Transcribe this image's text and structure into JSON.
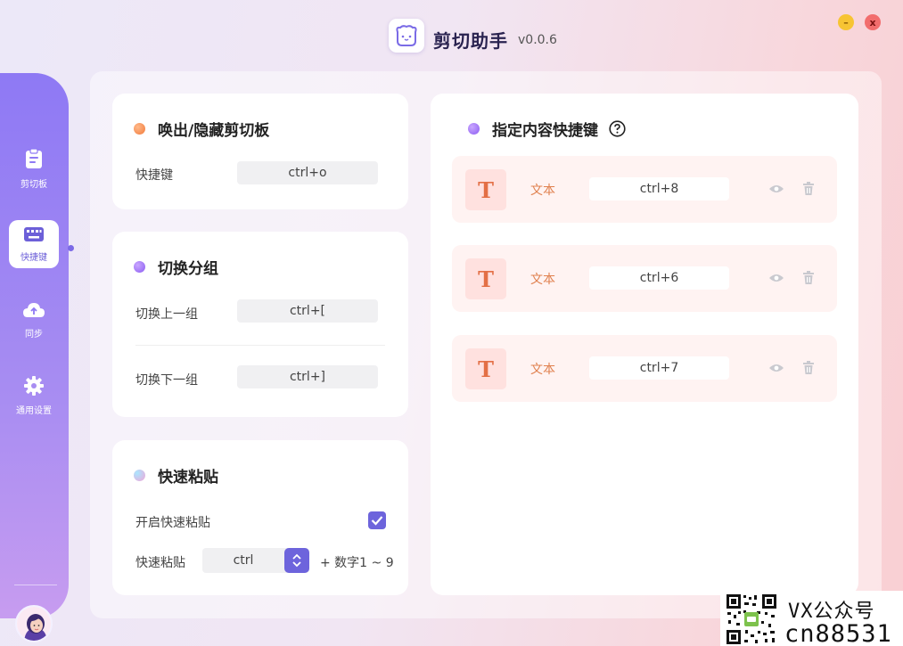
{
  "app": {
    "title": "剪切助手",
    "version": "v0.0.6",
    "minimize_glyph": "–",
    "close_glyph": "x"
  },
  "sidebar": {
    "items": [
      {
        "label": "剪切板",
        "icon": "clipboard-icon",
        "active": false
      },
      {
        "label": "快捷键",
        "icon": "keyboard-icon",
        "active": true
      },
      {
        "label": "同步",
        "icon": "cloud-sync-icon",
        "active": false
      },
      {
        "label": "通用设置",
        "icon": "gear-icon",
        "active": false
      }
    ],
    "avatar_icon": "user-avatar"
  },
  "toggle_card": {
    "title": "唤出/隐藏剪切板",
    "label": "快捷键",
    "value": "ctrl+o"
  },
  "group_card": {
    "title": "切换分组",
    "prev_label": "切换上一组",
    "prev_value": "ctrl+[",
    "next_label": "切换下一组",
    "next_value": "ctrl+]"
  },
  "paste_card": {
    "title": "快速粘贴",
    "enable_label": "开启快速粘贴",
    "enabled": true,
    "paste_label": "快速粘贴",
    "modifier_value": "ctrl",
    "suffix": "+ 数字1 ~ 9"
  },
  "content_card": {
    "title": "指定内容快捷键",
    "help_icon": "question-circle-icon",
    "rows": [
      {
        "type_icon": "T",
        "type_label": "文本",
        "shortcut": "ctrl+8"
      },
      {
        "type_icon": "T",
        "type_label": "文本",
        "shortcut": "ctrl+6"
      },
      {
        "type_icon": "T",
        "type_label": "文本",
        "shortcut": "ctrl+7"
      }
    ]
  },
  "watermark": {
    "line1": "VX公众号",
    "line2": "cn88531"
  },
  "colors": {
    "accent": "#6d64dc",
    "sidebar_top": "#8e79f4",
    "row_bg": "#fff3f2",
    "text_type": "#e0804e"
  }
}
